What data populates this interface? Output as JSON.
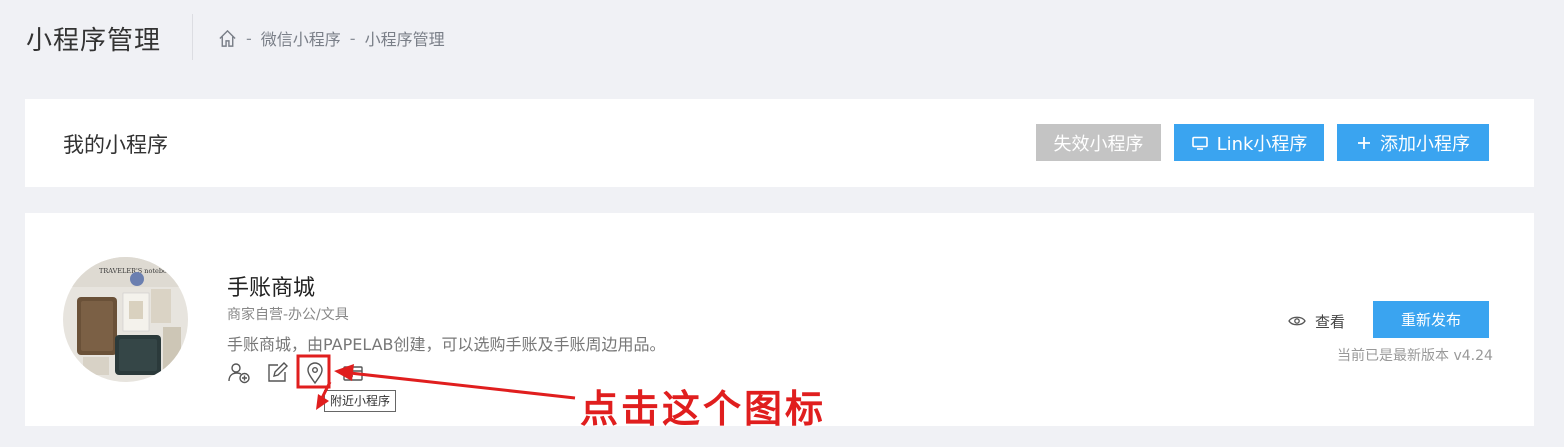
{
  "header": {
    "title": "小程序管理",
    "breadcrumb": [
      {
        "icon": "home-icon"
      },
      {
        "label": "微信小程序"
      },
      {
        "label": "小程序管理"
      }
    ],
    "separator": "-"
  },
  "my_apps": {
    "title": "我的小程序",
    "buttons": {
      "invalid": "失效小程序",
      "link": "Link小程序",
      "add": "添加小程序"
    },
    "button_icons": {
      "link": "monitor-icon",
      "add": "plus-icon"
    }
  },
  "app": {
    "name": "手账商城",
    "category": "商家自营-办公/文具",
    "description": "手账商城，由PAPELAB创建，可以选购手账及手账周边用品。",
    "avatar_text": "TRAVELER'S notebook",
    "actions": [
      {
        "icon": "add-user-icon"
      },
      {
        "icon": "edit-icon"
      },
      {
        "icon": "location-icon",
        "highlighted": true
      },
      {
        "icon": "card-icon"
      }
    ],
    "tooltip": "附近小程序",
    "view_label": "查看",
    "republish_label": "重新发布",
    "version_note": "当前已是最新版本 v4.24"
  },
  "annotation": {
    "text": "点击这个图标",
    "color": "#e01e1e"
  },
  "colors": {
    "background": "#f0f1f5",
    "primary": "#3aa4f0",
    "disabled": "#c4c4c4",
    "annotation": "#e01e1e"
  }
}
